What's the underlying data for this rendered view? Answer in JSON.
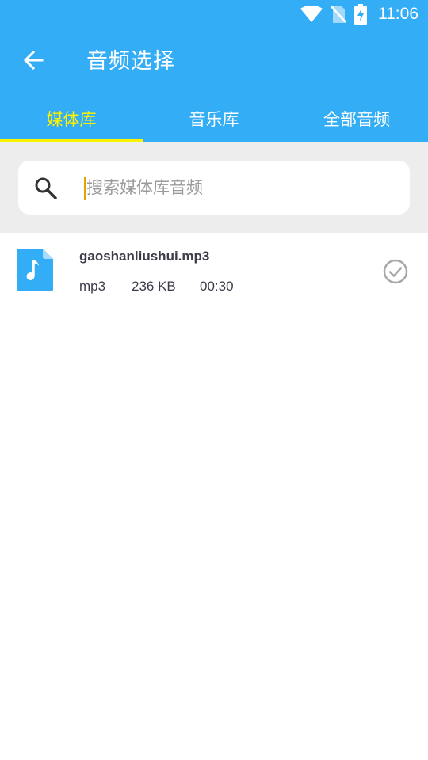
{
  "status_bar": {
    "time": "11:06",
    "icons": [
      "wifi-icon",
      "no-sim-icon",
      "battery-charging-icon"
    ]
  },
  "header": {
    "title": "音频选择",
    "back_icon": "arrow-left-icon"
  },
  "tabs": [
    {
      "label": "媒体库",
      "active": true
    },
    {
      "label": "音乐库",
      "active": false
    },
    {
      "label": "全部音频",
      "active": false
    }
  ],
  "search": {
    "placeholder": "搜索媒体库音频",
    "value": ""
  },
  "audio_files": [
    {
      "name": "gaoshanliushui.mp3",
      "ext": "mp3",
      "size": "236 KB",
      "duration": "00:30",
      "icon": "music-file-icon",
      "selected": false
    }
  ],
  "colors": {
    "primary": "#33adf5",
    "tab_active": "#fff200",
    "search_bg": "#ededed",
    "caret": "#e8a200"
  }
}
